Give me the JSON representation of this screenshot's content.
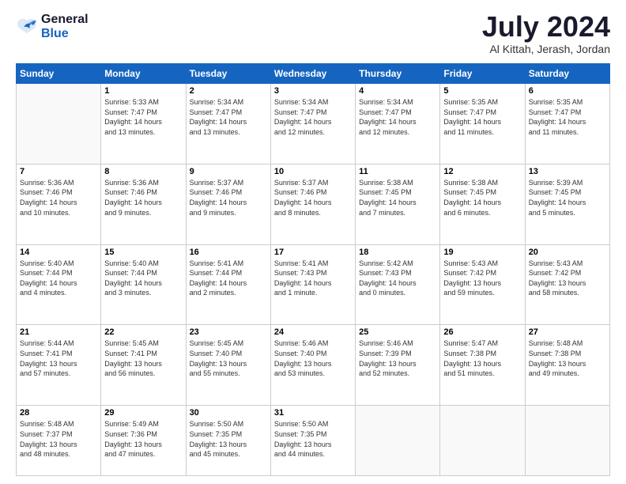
{
  "header": {
    "logo_line1": "General",
    "logo_line2": "Blue",
    "month": "July 2024",
    "location": "Al Kittah, Jerash, Jordan"
  },
  "weekdays": [
    "Sunday",
    "Monday",
    "Tuesday",
    "Wednesday",
    "Thursday",
    "Friday",
    "Saturday"
  ],
  "weeks": [
    [
      {
        "day": "",
        "info": ""
      },
      {
        "day": "1",
        "info": "Sunrise: 5:33 AM\nSunset: 7:47 PM\nDaylight: 14 hours\nand 13 minutes."
      },
      {
        "day": "2",
        "info": "Sunrise: 5:34 AM\nSunset: 7:47 PM\nDaylight: 14 hours\nand 13 minutes."
      },
      {
        "day": "3",
        "info": "Sunrise: 5:34 AM\nSunset: 7:47 PM\nDaylight: 14 hours\nand 12 minutes."
      },
      {
        "day": "4",
        "info": "Sunrise: 5:34 AM\nSunset: 7:47 PM\nDaylight: 14 hours\nand 12 minutes."
      },
      {
        "day": "5",
        "info": "Sunrise: 5:35 AM\nSunset: 7:47 PM\nDaylight: 14 hours\nand 11 minutes."
      },
      {
        "day": "6",
        "info": "Sunrise: 5:35 AM\nSunset: 7:47 PM\nDaylight: 14 hours\nand 11 minutes."
      }
    ],
    [
      {
        "day": "7",
        "info": "Sunrise: 5:36 AM\nSunset: 7:46 PM\nDaylight: 14 hours\nand 10 minutes."
      },
      {
        "day": "8",
        "info": "Sunrise: 5:36 AM\nSunset: 7:46 PM\nDaylight: 14 hours\nand 9 minutes."
      },
      {
        "day": "9",
        "info": "Sunrise: 5:37 AM\nSunset: 7:46 PM\nDaylight: 14 hours\nand 9 minutes."
      },
      {
        "day": "10",
        "info": "Sunrise: 5:37 AM\nSunset: 7:46 PM\nDaylight: 14 hours\nand 8 minutes."
      },
      {
        "day": "11",
        "info": "Sunrise: 5:38 AM\nSunset: 7:45 PM\nDaylight: 14 hours\nand 7 minutes."
      },
      {
        "day": "12",
        "info": "Sunrise: 5:38 AM\nSunset: 7:45 PM\nDaylight: 14 hours\nand 6 minutes."
      },
      {
        "day": "13",
        "info": "Sunrise: 5:39 AM\nSunset: 7:45 PM\nDaylight: 14 hours\nand 5 minutes."
      }
    ],
    [
      {
        "day": "14",
        "info": "Sunrise: 5:40 AM\nSunset: 7:44 PM\nDaylight: 14 hours\nand 4 minutes."
      },
      {
        "day": "15",
        "info": "Sunrise: 5:40 AM\nSunset: 7:44 PM\nDaylight: 14 hours\nand 3 minutes."
      },
      {
        "day": "16",
        "info": "Sunrise: 5:41 AM\nSunset: 7:44 PM\nDaylight: 14 hours\nand 2 minutes."
      },
      {
        "day": "17",
        "info": "Sunrise: 5:41 AM\nSunset: 7:43 PM\nDaylight: 14 hours\nand 1 minute."
      },
      {
        "day": "18",
        "info": "Sunrise: 5:42 AM\nSunset: 7:43 PM\nDaylight: 14 hours\nand 0 minutes."
      },
      {
        "day": "19",
        "info": "Sunrise: 5:43 AM\nSunset: 7:42 PM\nDaylight: 13 hours\nand 59 minutes."
      },
      {
        "day": "20",
        "info": "Sunrise: 5:43 AM\nSunset: 7:42 PM\nDaylight: 13 hours\nand 58 minutes."
      }
    ],
    [
      {
        "day": "21",
        "info": "Sunrise: 5:44 AM\nSunset: 7:41 PM\nDaylight: 13 hours\nand 57 minutes."
      },
      {
        "day": "22",
        "info": "Sunrise: 5:45 AM\nSunset: 7:41 PM\nDaylight: 13 hours\nand 56 minutes."
      },
      {
        "day": "23",
        "info": "Sunrise: 5:45 AM\nSunset: 7:40 PM\nDaylight: 13 hours\nand 55 minutes."
      },
      {
        "day": "24",
        "info": "Sunrise: 5:46 AM\nSunset: 7:40 PM\nDaylight: 13 hours\nand 53 minutes."
      },
      {
        "day": "25",
        "info": "Sunrise: 5:46 AM\nSunset: 7:39 PM\nDaylight: 13 hours\nand 52 minutes."
      },
      {
        "day": "26",
        "info": "Sunrise: 5:47 AM\nSunset: 7:38 PM\nDaylight: 13 hours\nand 51 minutes."
      },
      {
        "day": "27",
        "info": "Sunrise: 5:48 AM\nSunset: 7:38 PM\nDaylight: 13 hours\nand 49 minutes."
      }
    ],
    [
      {
        "day": "28",
        "info": "Sunrise: 5:48 AM\nSunset: 7:37 PM\nDaylight: 13 hours\nand 48 minutes."
      },
      {
        "day": "29",
        "info": "Sunrise: 5:49 AM\nSunset: 7:36 PM\nDaylight: 13 hours\nand 47 minutes."
      },
      {
        "day": "30",
        "info": "Sunrise: 5:50 AM\nSunset: 7:35 PM\nDaylight: 13 hours\nand 45 minutes."
      },
      {
        "day": "31",
        "info": "Sunrise: 5:50 AM\nSunset: 7:35 PM\nDaylight: 13 hours\nand 44 minutes."
      },
      {
        "day": "",
        "info": ""
      },
      {
        "day": "",
        "info": ""
      },
      {
        "day": "",
        "info": ""
      }
    ]
  ]
}
